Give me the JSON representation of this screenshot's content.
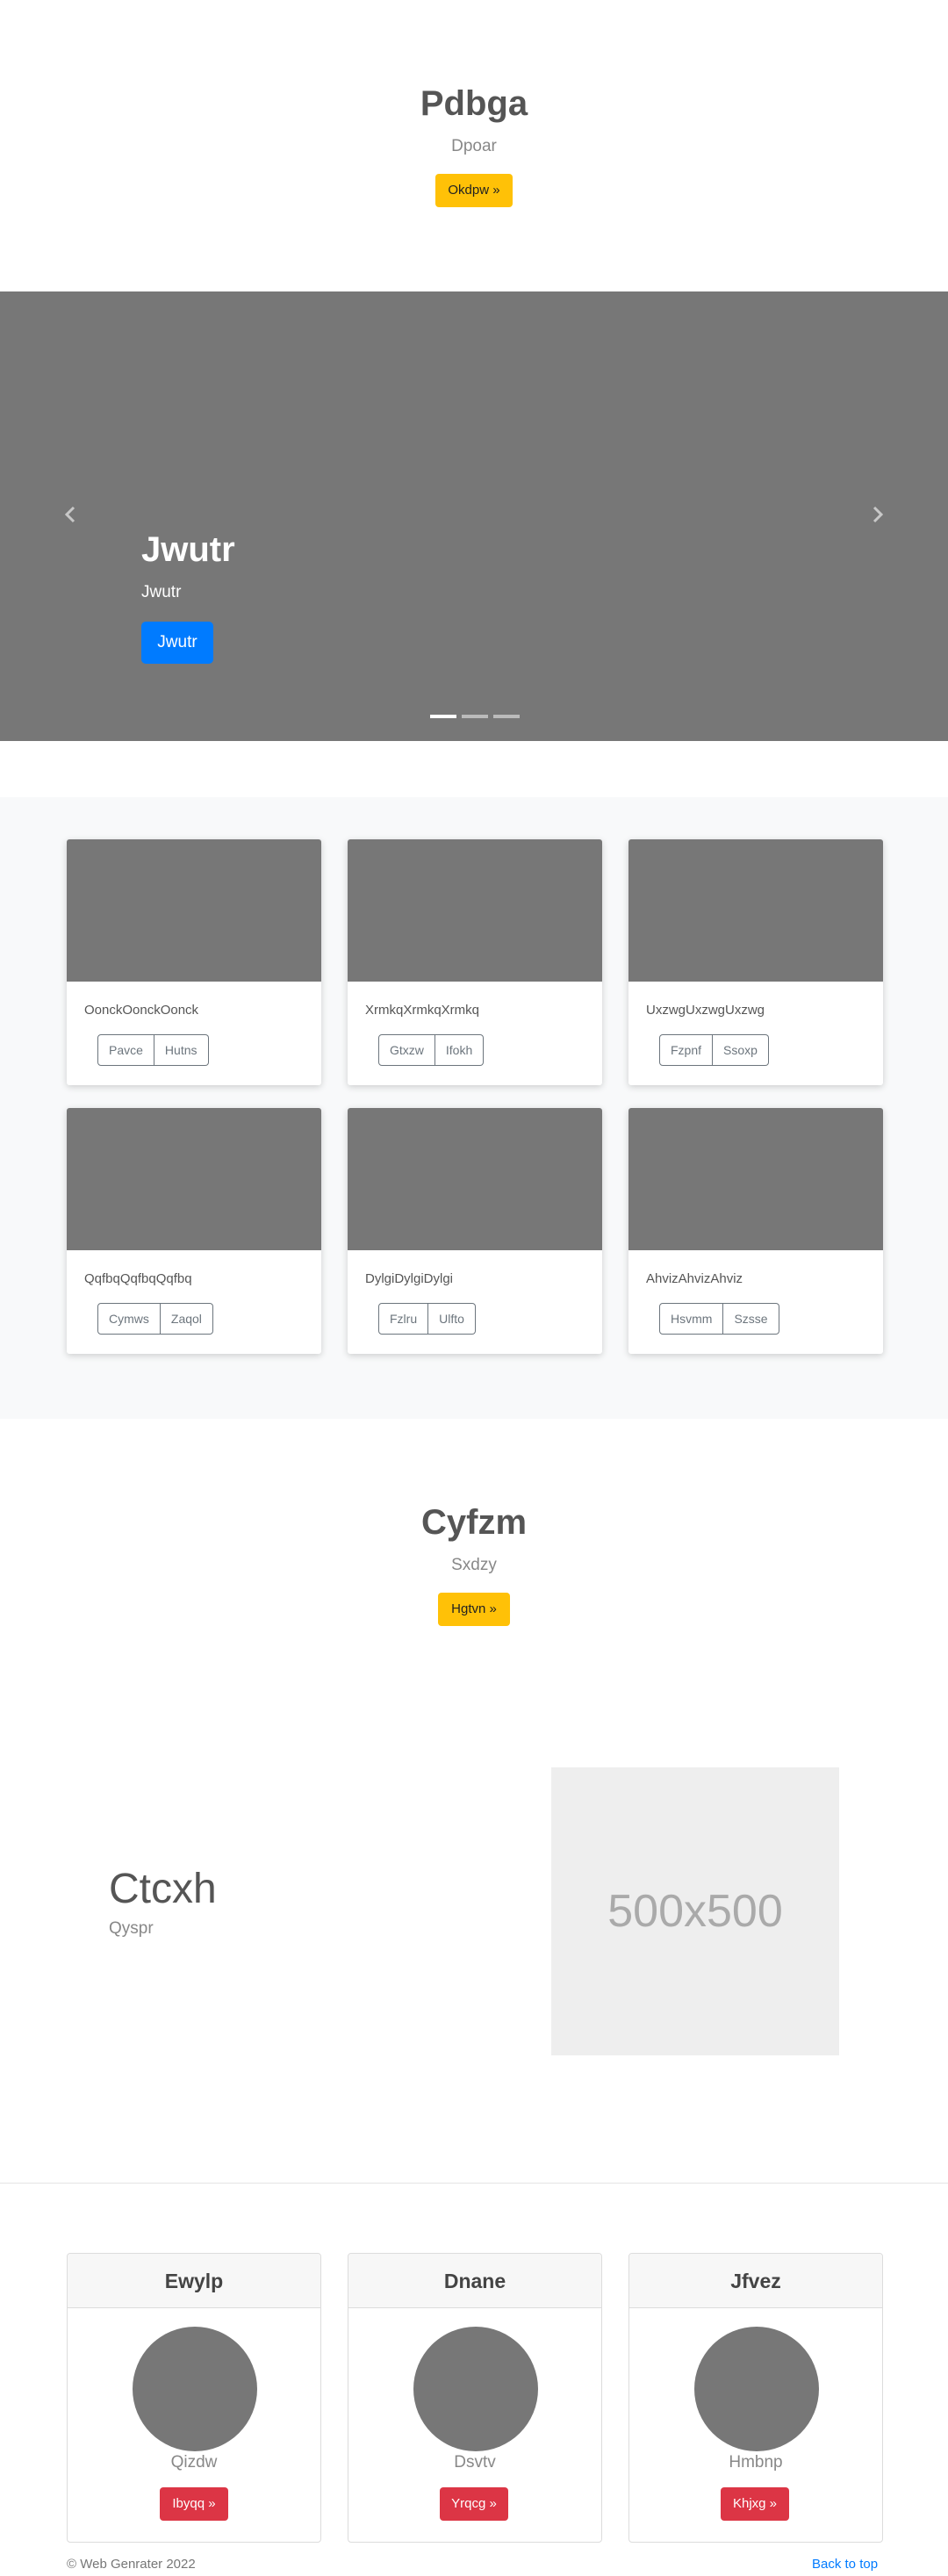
{
  "hero": {
    "title": "Pdbga",
    "subtitle": "Dpoar",
    "button": "Okdpw »"
  },
  "carousel": {
    "title": "Jwutr",
    "subtitle": "Jwutr",
    "button": "Jwutr",
    "prev_icon": "chevron-left-icon",
    "next_icon": "chevron-right-icon",
    "active_slide": 1,
    "slide_count": 3
  },
  "album": {
    "cards": [
      {
        "text": "OonckOonckOonck",
        "buttons": [
          "Pavce",
          "Hutns"
        ]
      },
      {
        "text": "XrmkqXrmkqXrmkq",
        "buttons": [
          "Gtxzw",
          "Ifokh"
        ]
      },
      {
        "text": "UxzwgUxzwgUxzwg",
        "buttons": [
          "Fzpnf",
          "Ssoxp"
        ]
      },
      {
        "text": "QqfbqQqfbqQqfbq",
        "buttons": [
          "Cymws",
          "Zaqol"
        ]
      },
      {
        "text": "DylgiDylgiDylgi",
        "buttons": [
          "Fzlru",
          "Ulfto"
        ]
      },
      {
        "text": "AhvizAhvizAhviz",
        "buttons": [
          "Hsvmm",
          "Szsse"
        ]
      }
    ]
  },
  "hero2": {
    "title": "Cyfzm",
    "subtitle": "Sxdzy",
    "button": "Hgtvn »"
  },
  "featurette": {
    "title": "Ctcxh",
    "subtitle": "Qyspr",
    "image_label": "500x500"
  },
  "pricing": [
    {
      "header": "Ewylp",
      "name": "Qizdw",
      "button": "Ibyqq »"
    },
    {
      "header": "Dnane",
      "name": "Dsvtv",
      "button": "Yrqcg »"
    },
    {
      "header": "Jfvez",
      "name": "Hmbnp",
      "button": "Khjxg »"
    }
  ],
  "footer": {
    "copyright": "© Web Genrater 2022",
    "back_to_top": "Back to top"
  },
  "colors": {
    "accent_yellow": "#ffc107",
    "primary_blue": "#007bff",
    "danger_red": "#dc3545",
    "placeholder_gray": "#777777"
  }
}
